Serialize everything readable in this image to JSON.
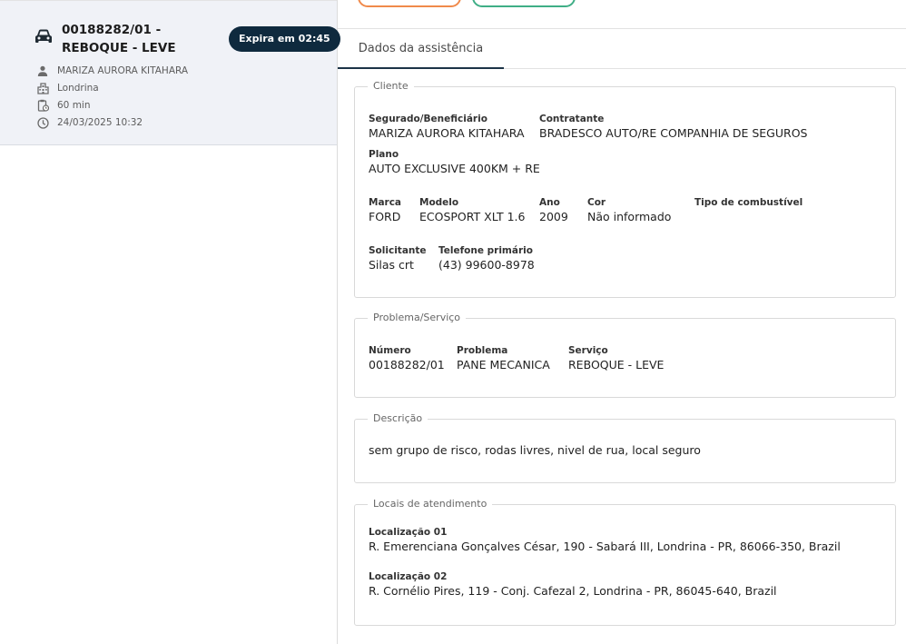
{
  "card": {
    "title": "00188282/01 - REBOQUE - LEVE",
    "expira": "Expira em 02:45",
    "person": "MARIZA AURORA KITAHARA",
    "city": "Londrina",
    "duration": "60 min",
    "datetime": "24/03/2025 10:32",
    "icons": [
      "car-icon",
      "person-icon",
      "building-icon",
      "clipboard-clock-icon",
      "clock-icon"
    ]
  },
  "tabs": {
    "active": "Dados da assistência"
  },
  "cliente": {
    "legend": "Cliente",
    "segurado_label": "Segurado/Beneficiário",
    "segurado_value": "MARIZA AURORA KITAHARA",
    "contratante_label": "Contratante",
    "contratante_value": "BRADESCO AUTO/RE COMPANHIA DE SEGUROS",
    "plano_label": "Plano",
    "plano_value": "AUTO EXCLUSIVE 400KM + RE",
    "marca_label": "Marca",
    "marca_value": "FORD",
    "modelo_label": "Modelo",
    "modelo_value": "ECOSPORT XLT 1.6",
    "ano_label": "Ano",
    "ano_value": "2009",
    "cor_label": "Cor",
    "cor_value": "Não informado",
    "combustivel_label": "Tipo de combustível",
    "solicitante_label": "Solicitante",
    "solicitante_value": "Silas crt",
    "telefone_label": "Telefone primário",
    "telefone_value": "(43) 99600-8978"
  },
  "problema": {
    "legend": "Problema/Serviço",
    "numero_label": "Número",
    "numero_value": "00188282/01",
    "problema_label": "Problema",
    "problema_value": "PANE MECANICA",
    "servico_label": "Serviço",
    "servico_value": "REBOQUE - LEVE"
  },
  "descricao": {
    "legend": "Descrição",
    "text": "sem grupo de risco, rodas livres, nivel de rua, local seguro"
  },
  "locais": {
    "legend": "Locais de atendimento",
    "loc1_label": "Localização 01",
    "loc1_value": "R. Emerenciana Gonçalves César, 190 - Sabará III, Londrina - PR, 86066-350, Brazil",
    "loc2_label": "Localização 02",
    "loc2_value": "R. Cornélio Pires, 119 - Conj. Cafezal 2, Londrina - PR, 86045-640, Brazil"
  },
  "colors": {
    "badge": "#0f2a3e",
    "tab_underline": "#1c3347",
    "pill_orange": "#f08a4b",
    "pill_green": "#3fae86",
    "card_bg": "#f0f2f7"
  }
}
